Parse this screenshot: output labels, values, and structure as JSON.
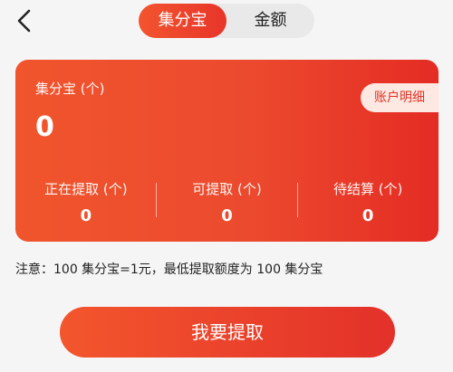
{
  "header": {
    "back_icon": "chevron-left-icon",
    "tabs": [
      {
        "label": "集分宝",
        "active": true
      },
      {
        "label": "金额",
        "active": false
      }
    ]
  },
  "card": {
    "title": "集分宝 (个)",
    "value": "0",
    "detail_button": "账户明细",
    "stats": [
      {
        "label": "正在提取 (个)",
        "value": "0"
      },
      {
        "label": "可提取 (个)",
        "value": "0"
      },
      {
        "label": "待结算 (个)",
        "value": "0"
      }
    ]
  },
  "notice": "注意：100 集分宝=1元，最低提取额度为 100 集分宝",
  "action": {
    "withdraw_label": "我要提取"
  },
  "colors": {
    "accent": "#e7352a",
    "accent_light": "#f3542e",
    "background": "#f5f5f5",
    "detail_bg": "#fde8e2"
  }
}
